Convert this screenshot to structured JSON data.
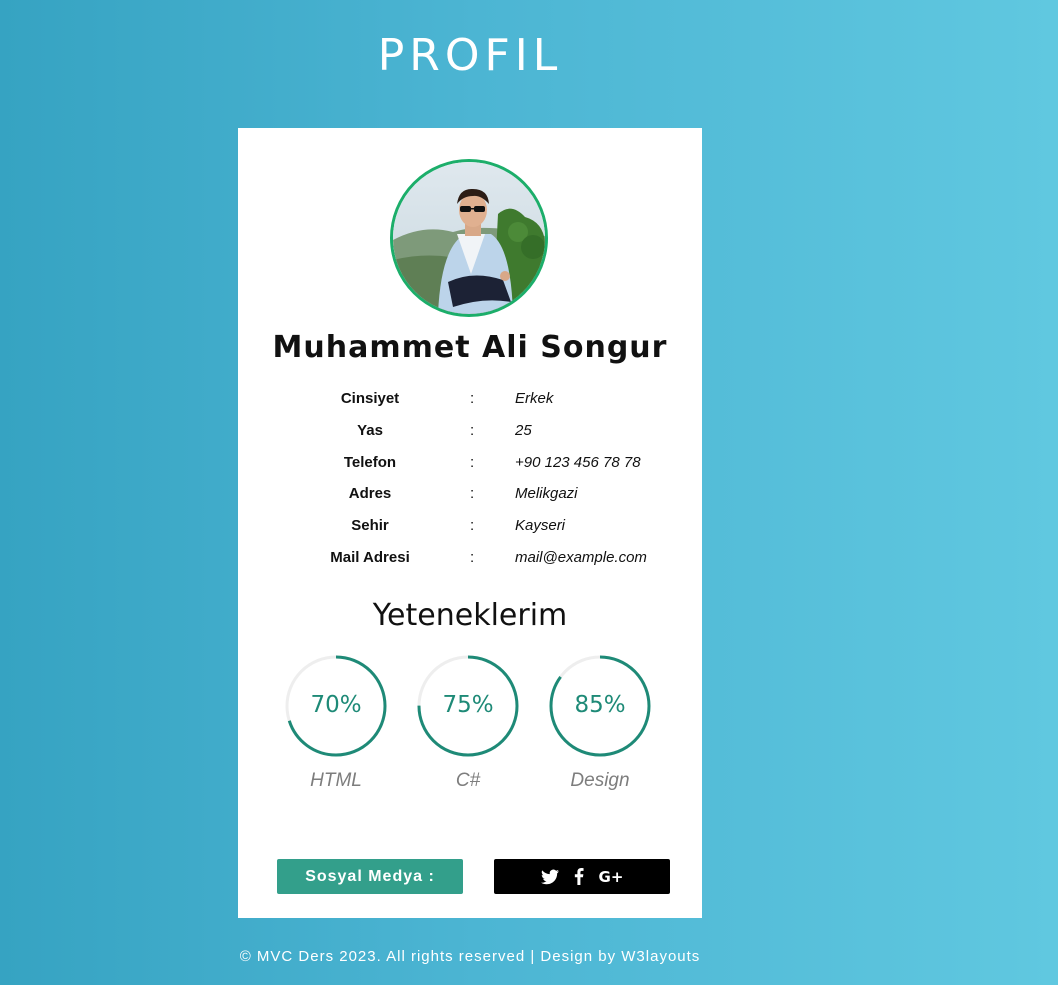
{
  "header": {
    "title": "PROFIL"
  },
  "profile": {
    "name": "Muhammet Ali Songur",
    "fields": [
      {
        "label": "Cinsiyet",
        "sep": ":",
        "value": "Erkek"
      },
      {
        "label": "Yas",
        "sep": ":",
        "value": "25"
      },
      {
        "label": "Telefon",
        "sep": ":",
        "value": "+90 123 456 78 78"
      },
      {
        "label": "Adres",
        "sep": ":",
        "value": "Melikgazi"
      },
      {
        "label": "Sehir",
        "sep": ":",
        "value": "Kayseri"
      },
      {
        "label": "Mail Adresi",
        "sep": ":",
        "value": "mail@example.com"
      }
    ]
  },
  "skills": {
    "title": "Yeteneklerim",
    "items": [
      {
        "name": "HTML",
        "value_text": "70%",
        "percent": 70
      },
      {
        "name": "C#",
        "value_text": "75%",
        "percent": 75
      },
      {
        "name": "Design",
        "value_text": "85%",
        "percent": 85
      }
    ]
  },
  "social": {
    "label": "Sosyal Medya :",
    "icons": [
      "twitter-icon",
      "facebook-icon",
      "google-plus-icon"
    ],
    "gplus_text": "G+"
  },
  "footer": {
    "text": "© MVC Ders 2023. All rights reserved | Design by W3layouts"
  },
  "colors": {
    "accent": "#339f8b",
    "skill_ring": "#1e8a77",
    "avatar_border": "#1cae6a",
    "background_start": "#36a3c2",
    "background_end": "#60c8e0"
  }
}
